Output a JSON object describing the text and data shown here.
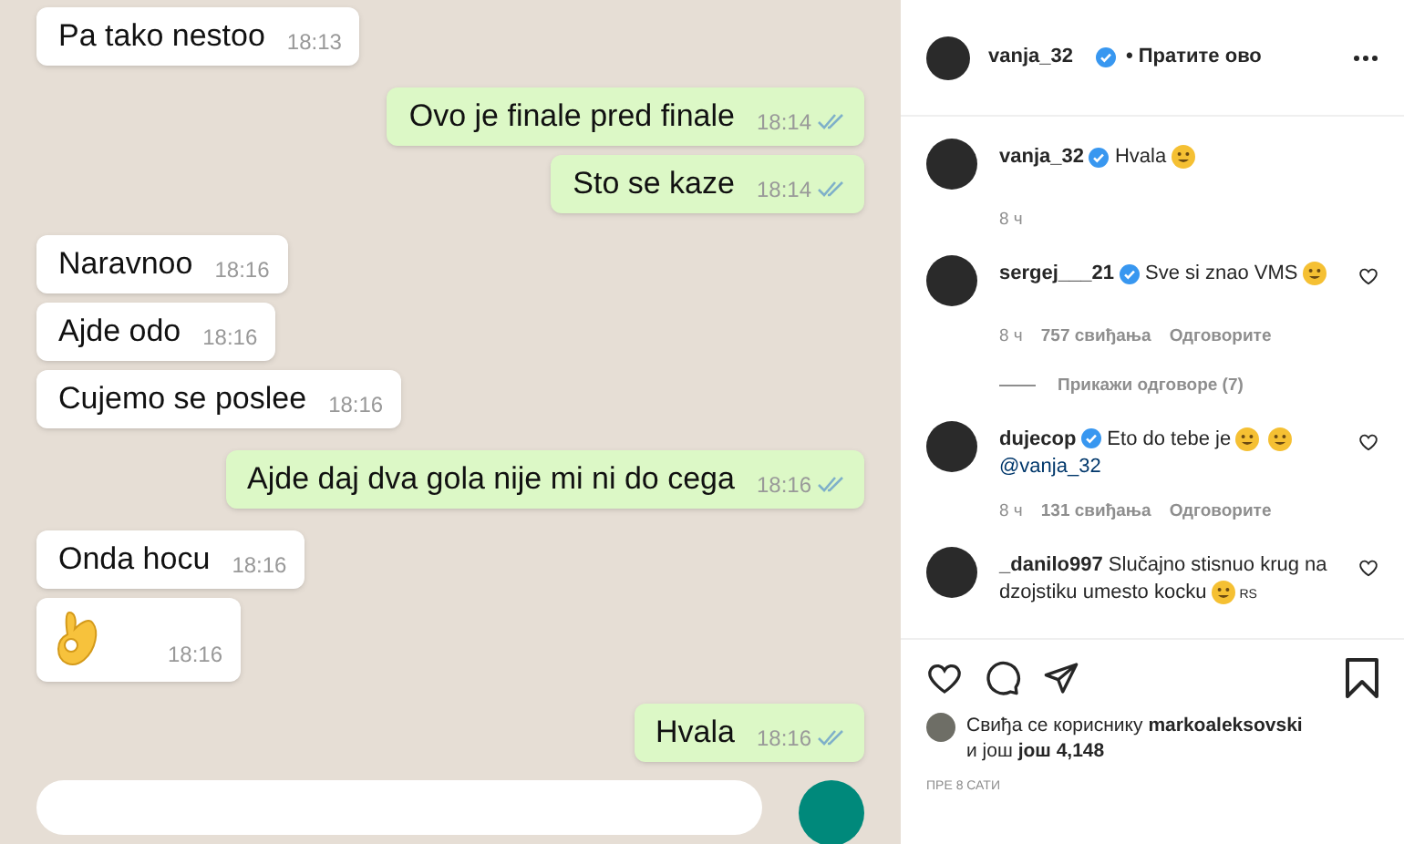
{
  "chat": {
    "messages": [
      {
        "kind": "text",
        "outgoing": false,
        "text": "Pa tako nestoo",
        "time": "18:13"
      },
      {
        "kind": "text",
        "outgoing": true,
        "text": "Ovo je finale pred finale",
        "time": "18:14"
      },
      {
        "kind": "text",
        "outgoing": true,
        "text": "Sto se kaze",
        "time": "18:14"
      },
      {
        "kind": "text",
        "outgoing": false,
        "text": "Naravnoo",
        "time": "18:16"
      },
      {
        "kind": "text",
        "outgoing": false,
        "text": "Ajde odo",
        "time": "18:16"
      },
      {
        "kind": "text",
        "outgoing": false,
        "text": "Cujemo se poslee",
        "time": "18:16"
      },
      {
        "kind": "text",
        "outgoing": true,
        "text": "Ajde daj dva gola nije mi ni do cega",
        "time": "18:16"
      },
      {
        "kind": "text",
        "outgoing": false,
        "text": "Onda hocu",
        "time": "18:16"
      },
      {
        "kind": "emoji",
        "outgoing": false,
        "time": "18:16"
      },
      {
        "kind": "text",
        "outgoing": true,
        "text": "Hvala",
        "time": "18:16"
      }
    ]
  },
  "post": {
    "author": "vanja_32",
    "follow": "• Пратите ово",
    "comments": [
      {
        "user": "vanja_32",
        "verified": true,
        "segments": [
          {
            "kind": "text",
            "text": "Hvala"
          },
          {
            "kind": "emoji"
          }
        ],
        "time": "8 ч"
      },
      {
        "user": "sergej___21",
        "verified": true,
        "segments": [
          {
            "kind": "text",
            "text": "Sve si znao VMS"
          },
          {
            "kind": "emoji"
          }
        ],
        "time": "8 ч",
        "likes": "757 свиђања",
        "reply": "Одговорите",
        "replies": "Прикажи одговоре (7)",
        "like_button": true
      },
      {
        "user": "dujecop",
        "verified": true,
        "segments": [
          {
            "kind": "text",
            "text": "Eto do tebe je"
          },
          {
            "kind": "emoji"
          },
          {
            "kind": "emoji"
          },
          {
            "kind": "mention",
            "text": "@vanja_32"
          }
        ],
        "time": "8 ч",
        "likes": "131 свиђања",
        "reply": "Одговорите",
        "like_button": true
      },
      {
        "user": "_danilo997",
        "verified": false,
        "segments": [
          {
            "kind": "text",
            "text": "Slučajno stisnuo krug na dzojstiku umesto kocku"
          },
          {
            "kind": "emoji"
          },
          {
            "kind": "small",
            "text": "RS"
          }
        ],
        "like_button": true
      }
    ],
    "liked_by_prefix": "Свиђа се кориснику",
    "liked_by_user": "markoaleksovski",
    "liked_by_more_prefix": "и још",
    "liked_by_more": "још 4,148",
    "posted": "ПРЕ 8 САТИ"
  }
}
